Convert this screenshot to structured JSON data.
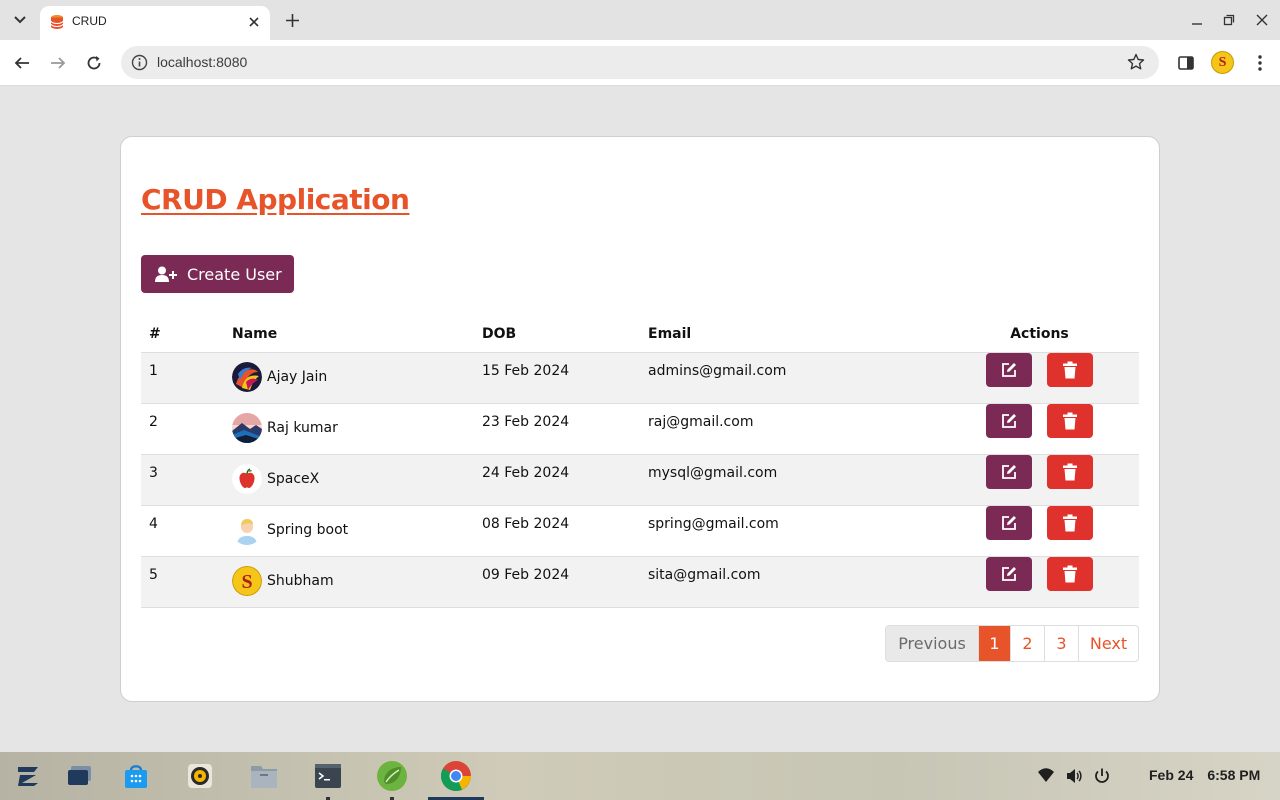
{
  "browser": {
    "tab_title": "CRUD",
    "url": "localhost:8080"
  },
  "app": {
    "title": "CRUD Application",
    "create_button_label": "Create User"
  },
  "table": {
    "headers": {
      "num": "#",
      "name": "Name",
      "dob": "DOB",
      "email": "Email",
      "actions": "Actions"
    },
    "rows": [
      {
        "num": "1",
        "name": "Ajay Jain",
        "dob": "15 Feb 2024",
        "email": "admins@gmail.com",
        "avatar": "colorful-abstract-avatar"
      },
      {
        "num": "2",
        "name": "Raj kumar",
        "dob": "23 Feb 2024",
        "email": "raj@gmail.com",
        "avatar": "landscape-avatar"
      },
      {
        "num": "3",
        "name": "SpaceX",
        "dob": "24 Feb 2024",
        "email": "mysql@gmail.com",
        "avatar": "apple-avatar"
      },
      {
        "num": "4",
        "name": "Spring boot",
        "dob": "08 Feb 2024",
        "email": "spring@gmail.com",
        "avatar": "person-avatar"
      },
      {
        "num": "5",
        "name": "Shubham",
        "dob": "09 Feb 2024",
        "email": "sita@gmail.com",
        "avatar": "letter-s-avatar"
      }
    ]
  },
  "pagination": {
    "previous": "Previous",
    "pages": [
      "1",
      "2",
      "3"
    ],
    "current": "1",
    "next": "Next"
  },
  "taskbar": {
    "date": "Feb 24",
    "time": "6:58 PM"
  },
  "colors": {
    "accent": "#e8542a",
    "primary_button": "#7a2a54",
    "danger_button": "#e0322c"
  }
}
